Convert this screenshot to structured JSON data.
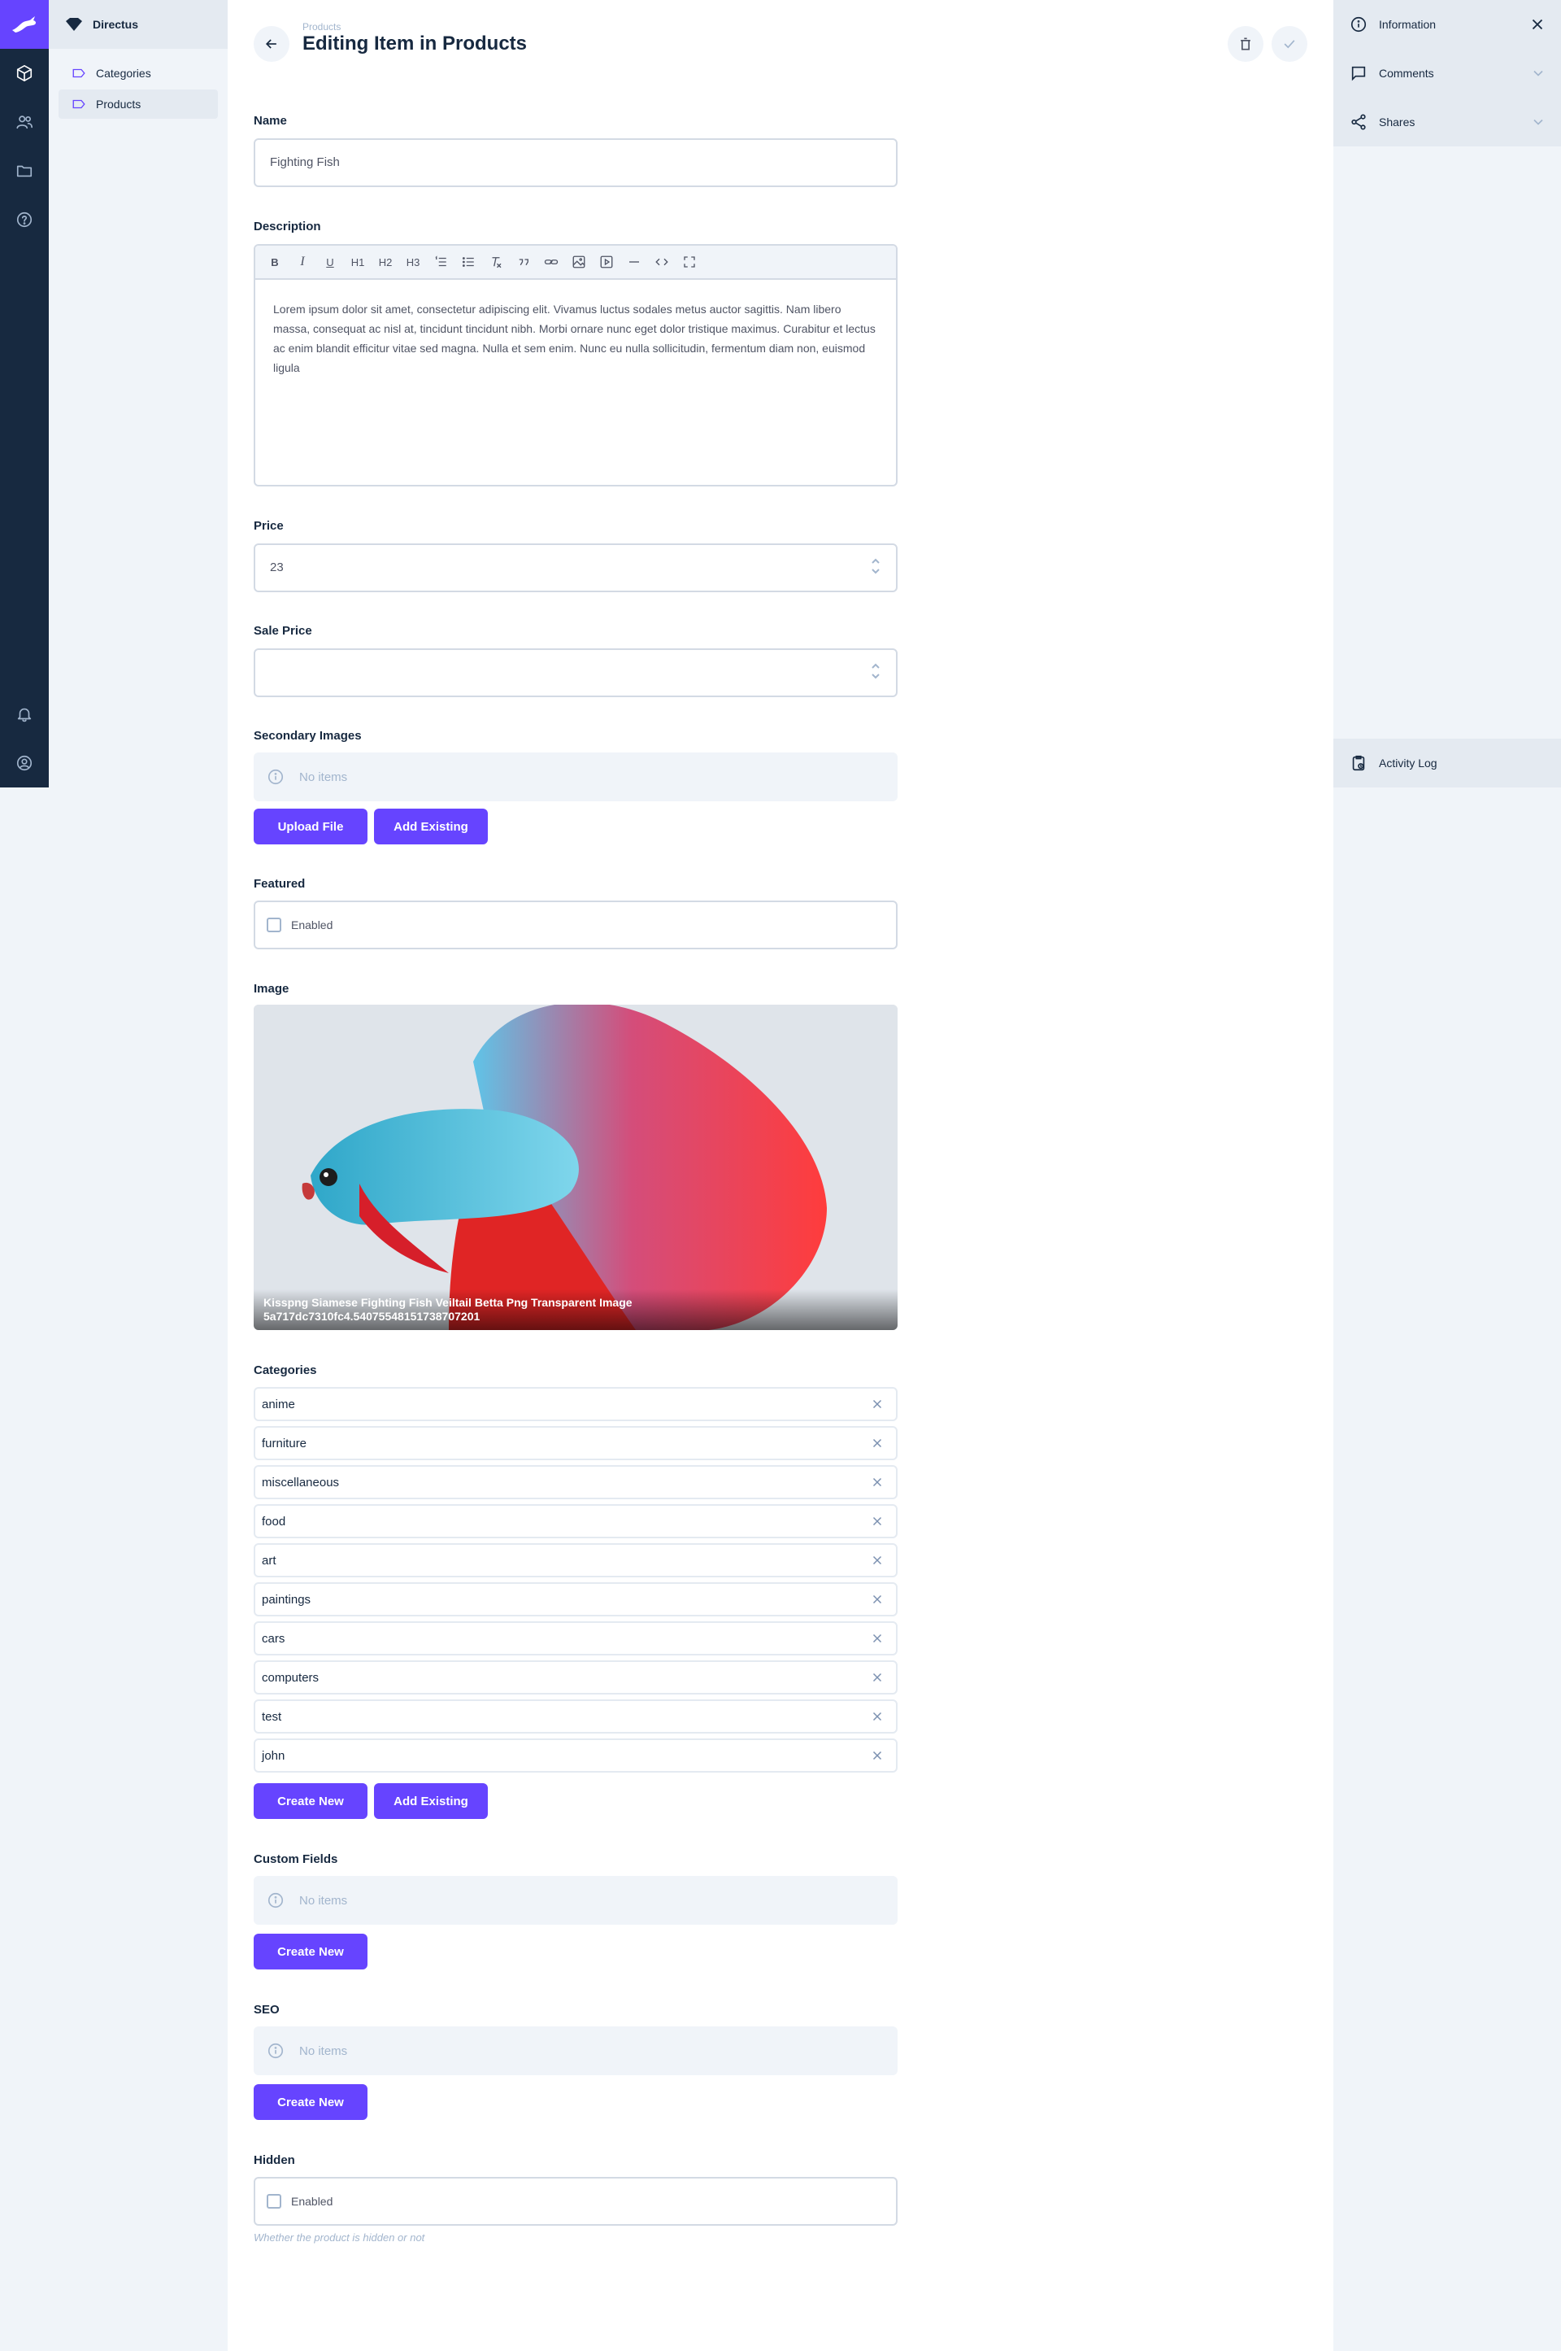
{
  "nav": {
    "project_name": "Directus",
    "items": [
      {
        "label": "Categories"
      },
      {
        "label": "Products"
      }
    ]
  },
  "header": {
    "breadcrumb": "Products",
    "title": "Editing Item in Products"
  },
  "fields": {
    "name": {
      "label": "Name",
      "value": "Fighting Fish"
    },
    "description": {
      "label": "Description",
      "toolbar": [
        "B",
        "I",
        "U",
        "H1",
        "H2",
        "H3",
        "ordered-list-icon",
        "bullet-list-icon",
        "clear-format-icon",
        "blockquote-icon",
        "link-icon",
        "image-icon",
        "media-icon",
        "horizontal-rule-icon",
        "code-icon",
        "fullscreen-icon"
      ],
      "value": "Lorem ipsum dolor sit amet, consectetur adipiscing elit. Vivamus luctus sodales metus auctor sagittis. Nam libero massa, consequat ac nisl at, tincidunt tincidunt nibh. Morbi ornare nunc eget dolor tristique maximus. Curabitur et lectus ac enim blandit efficitur vitae sed magna. Nulla et sem enim. Nunc eu nulla sollicitudin, fermentum diam non, euismod ligula"
    },
    "price": {
      "label": "Price",
      "value": "23"
    },
    "sale_price": {
      "label": "Sale Price",
      "value": ""
    },
    "secondary_images": {
      "label": "Secondary Images",
      "empty": "No items",
      "upload_label": "Upload File",
      "add_existing_label": "Add Existing"
    },
    "featured": {
      "label": "Featured",
      "checkbox_label": "Enabled",
      "checked": false
    },
    "image": {
      "label": "Image",
      "caption_line1": "Kisspng Siamese Fighting Fish Veiltail Betta Png Transparent Image",
      "caption_line2": "5a717dc7310fc4.5407554815173870720​1"
    },
    "categories": {
      "label": "Categories",
      "items": [
        "anime",
        "furniture",
        "miscellaneous",
        "food",
        "art",
        "paintings",
        "cars",
        "computers",
        "test",
        "john"
      ],
      "create_label": "Create New",
      "add_existing_label": "Add Existing"
    },
    "custom_fields": {
      "label": "Custom Fields",
      "empty": "No items",
      "create_label": "Create New"
    },
    "seo": {
      "label": "SEO",
      "empty": "No items",
      "create_label": "Create New"
    },
    "hidden": {
      "label": "Hidden",
      "checkbox_label": "Enabled",
      "checked": false,
      "hint": "Whether the product is hidden or not"
    }
  },
  "sidebar": {
    "information": "Information",
    "comments": "Comments",
    "shares": "Shares",
    "activity": "Activity Log"
  },
  "colors": {
    "accent": "#6644ff",
    "module_bar": "#172940",
    "background": "#f0f4f9"
  }
}
